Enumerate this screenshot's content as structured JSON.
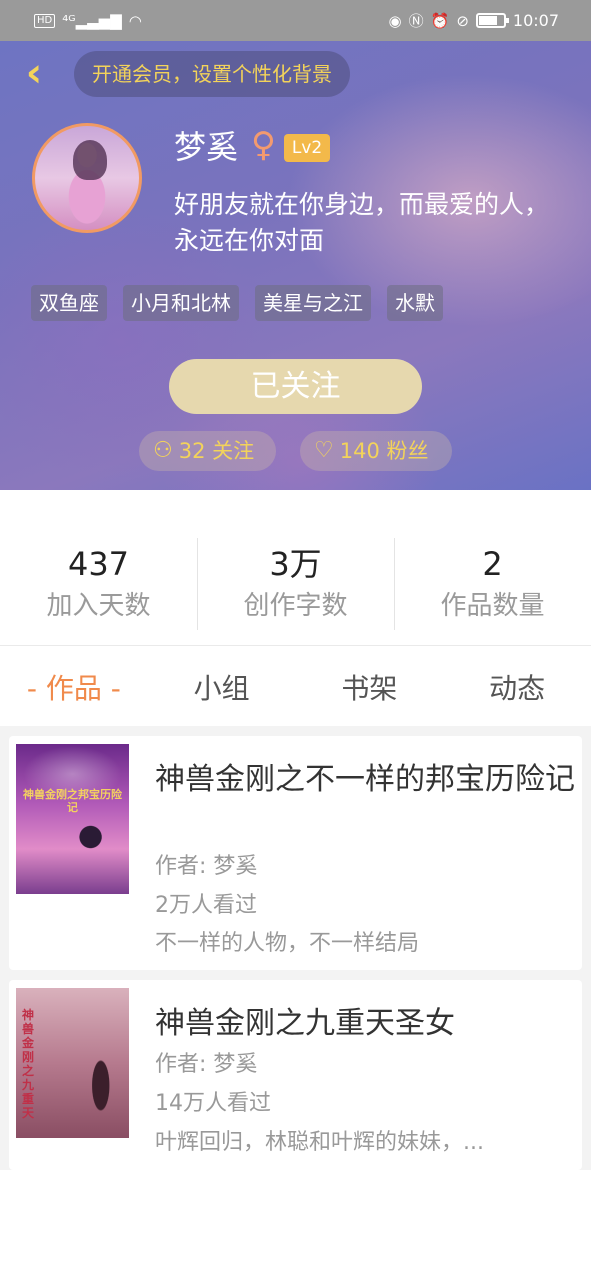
{
  "status_bar": {
    "left_icons": [
      "HD",
      "4G",
      "signal-icon",
      "wifi-icon"
    ],
    "right_icons": [
      "eye-icon",
      "nfc-icon",
      "alarm-icon",
      "mute-icon",
      "battery-icon"
    ],
    "time": "10:07"
  },
  "header": {
    "back_icon": "back-chevron-icon",
    "vip_prompt": "开通会员，设置个性化背景",
    "username": "梦奚",
    "gender_symbol": "♀",
    "level": "Lv2",
    "bio": "好朋友就在你身边，而最爱的人，永远在你对面",
    "tags": [
      "双鱼座",
      "小月和北林",
      "美星与之江",
      "水默"
    ],
    "follow_button": "已关注",
    "following": "32 关注",
    "fans": "140 粉丝",
    "colors": {
      "accent_yellow": "#f3d35a",
      "level_badge": "#f3b94a",
      "follow_btn": "#e6d8ae",
      "avatar_border": "#f19a63"
    }
  },
  "stats": [
    {
      "value": "437",
      "label": "加入天数"
    },
    {
      "value": "3万",
      "label": "创作字数"
    },
    {
      "value": "2",
      "label": "作品数量"
    }
  ],
  "tabs": [
    {
      "label": "- 作品 -",
      "active": true
    },
    {
      "label": "小组",
      "active": false
    },
    {
      "label": "书架",
      "active": false
    },
    {
      "label": "动态",
      "active": false
    }
  ],
  "tab_active_color": "#f08a4b",
  "works": [
    {
      "cover_text": "神兽金刚之邦宝历险记",
      "title": "神兽金刚之不一样的邦宝历险记",
      "author": "作者: 梦奚",
      "views": "2万人看过",
      "summary": "不一样的人物，不一样结局"
    },
    {
      "cover_text": "神兽金刚之九重天",
      "title": "神兽金刚之九重天圣女",
      "author": "作者: 梦奚",
      "views": "14万人看过",
      "summary": "叶辉回归，林聪和叶辉的妹妹，..."
    }
  ]
}
